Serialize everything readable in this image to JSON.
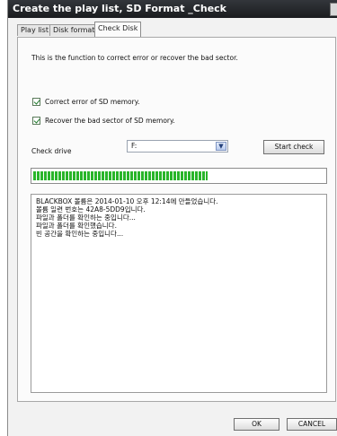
{
  "window": {
    "title": "Create the play list, SD Format _Check"
  },
  "tabs": [
    {
      "label": "Play list",
      "active": false
    },
    {
      "label": "Disk format",
      "active": false
    },
    {
      "label": "Check Disk",
      "active": true
    }
  ],
  "check_disk": {
    "description": "This is the function to correct error or recover the bad sector.",
    "options": [
      {
        "label": "Correct error of SD memory.",
        "checked": true
      },
      {
        "label": "Recover the bad sector of SD memory.",
        "checked": true
      }
    ],
    "check_drive_label": "Check drive",
    "drive_value": "F:",
    "start_button": "Start check",
    "progress_fraction": 0.6,
    "log_lines": [
      "BLACKBOX 볼륨은 2014-01-10 오후 12:14에 만들었습니다.",
      "볼륨 일련 번호는 42A8-5DD9입니다.",
      "파일과 폴더를 확인하는 중입니다...",
      "파일과 폴더를 확인했습니다.",
      "빈 공간을 확인하는 중입니다..."
    ]
  },
  "footer": {
    "ok_button": "OK",
    "cancel_button": "CANCEL"
  },
  "colors": {
    "progress": "#29b52a",
    "titlebar": "#1f2124"
  }
}
